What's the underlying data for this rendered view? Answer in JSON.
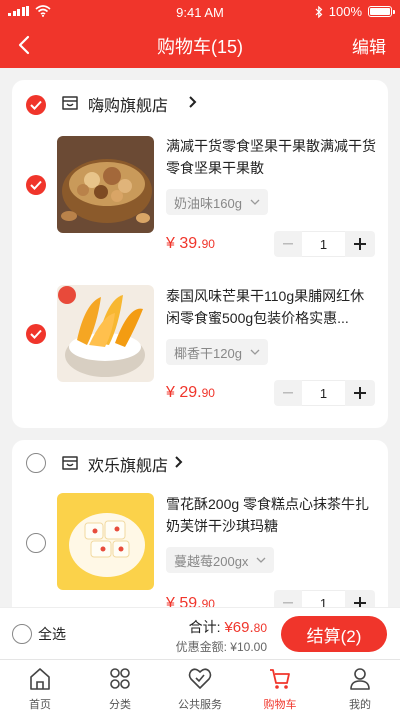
{
  "status_bar": {
    "time": "9:41 AM",
    "battery": "100%"
  },
  "nav": {
    "title": "购物车(15)",
    "edit": "编辑"
  },
  "stores": [
    {
      "name": "嗨购旗舰店",
      "items": [
        {
          "title": "满减干货零食坚果干果散满减干货零食坚果干果散",
          "spec": "奶油味160g",
          "price_big": "¥ 39.",
          "price_small": "90",
          "qty": "1"
        },
        {
          "title": "泰国风味芒果干110g果脯网红休闲零食蜜500g包装价格实惠...",
          "spec": "椰香干120g",
          "price_big": "¥ 29.",
          "price_small": "90",
          "qty": "1"
        }
      ]
    },
    {
      "name": "欢乐旗舰店",
      "items": [
        {
          "title": "雪花酥200g 零食糕点心抹茶牛扎奶芙饼干沙琪玛糖",
          "spec": "蔓越莓200gx",
          "price_big": "¥ 59.",
          "price_small": "90",
          "qty": "1"
        }
      ]
    }
  ],
  "footer": {
    "select_all": "全选",
    "total_label": "合计:",
    "total_big": "¥69.",
    "total_small": "80",
    "discount": "优惠金额: ¥10.00",
    "settle": "结算(2)"
  },
  "tabs": [
    {
      "label": "首页",
      "icon": "home-icon"
    },
    {
      "label": "分类",
      "icon": "category-icon"
    },
    {
      "label": "公共服务",
      "icon": "service-icon"
    },
    {
      "label": "购物车",
      "icon": "cart-icon"
    },
    {
      "label": "我的",
      "icon": "profile-icon"
    }
  ],
  "colors": {
    "accent": "#f0352b",
    "background": "#f2f2f2"
  }
}
